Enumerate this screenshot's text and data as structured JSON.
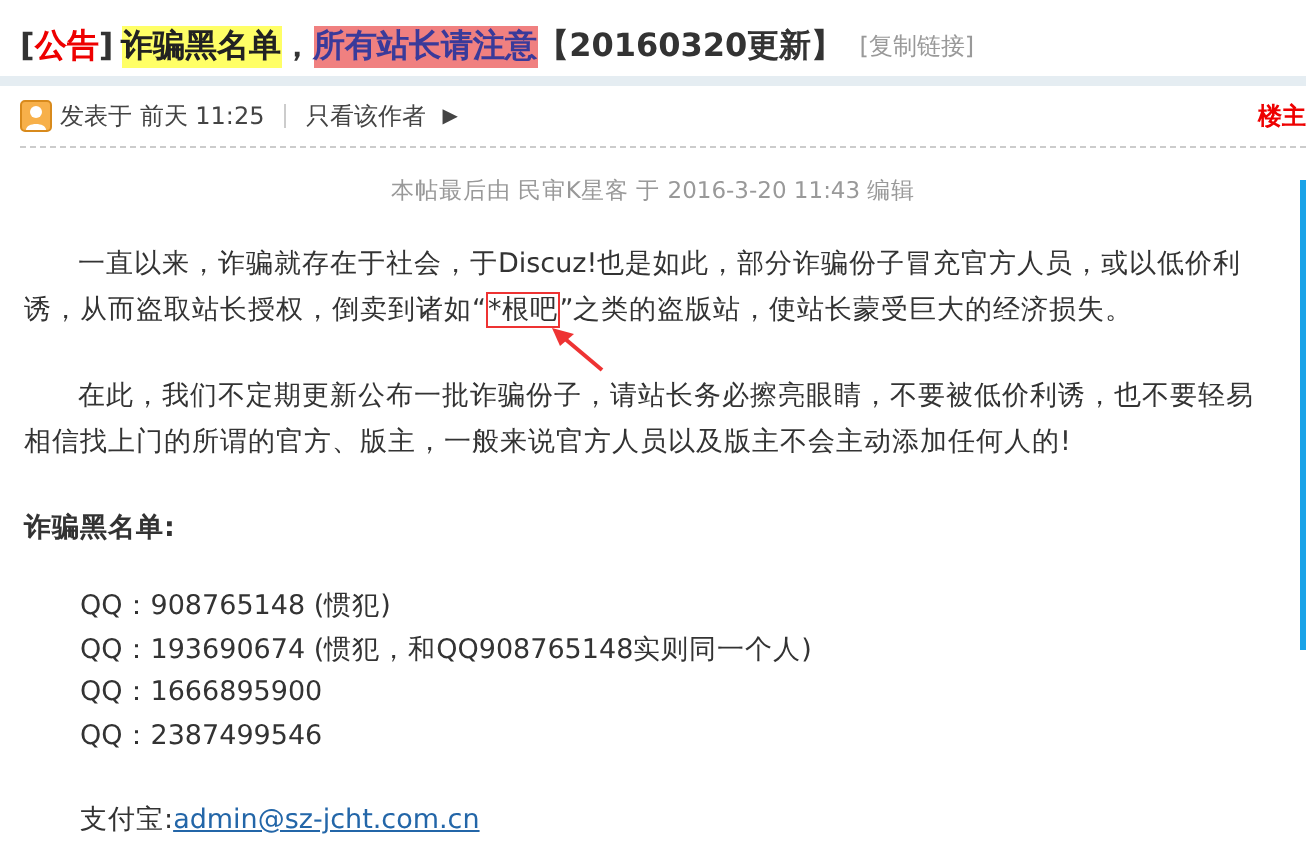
{
  "title": {
    "tag_open": "[",
    "tag": "公告",
    "tag_close": "]",
    "part1": "诈骗黑名单",
    "sep": "，",
    "part2": "所有站长请注意",
    "part3": "【20160320更新】",
    "copy_link": "[复制链接]"
  },
  "post_meta": {
    "posted": "发表于 前天 11:25",
    "author_only": "只看该作者",
    "arrow": "▶",
    "floor": "楼主"
  },
  "edit_note": "本帖最后由 民审K星客 于 2016-3-20 11:43 编辑",
  "paragraphs": [
    {
      "before": "一直以来，诈骗就存在于社会，于Discuz!也是如此，部分诈骗份子冒充官方人员，或以低价利诱，从而盗取站长授权，倒卖到诸如“",
      "boxed": "*根吧",
      "after": "”之类的盗版站，使站长蒙受巨大的经济损失。"
    },
    {
      "before": "在此，我们不定期更新公布一批诈骗份子，请站长务必擦亮眼睛，不要被低价利诱，也不要轻易相信找上门的所谓的官方、版主，一般来说官方人员以及版主不会主动添加任何人的!"
    }
  ],
  "list_heading": "诈骗黑名单:",
  "entries": [
    "QQ：908765148 (惯犯)",
    "QQ：193690674 (惯犯，和QQ908765148实则同一个人)",
    "QQ：1666895900",
    "QQ：2387499546"
  ],
  "alipay": {
    "label": "支付宝:",
    "link": "admin@sz-jcht.com.cn"
  }
}
